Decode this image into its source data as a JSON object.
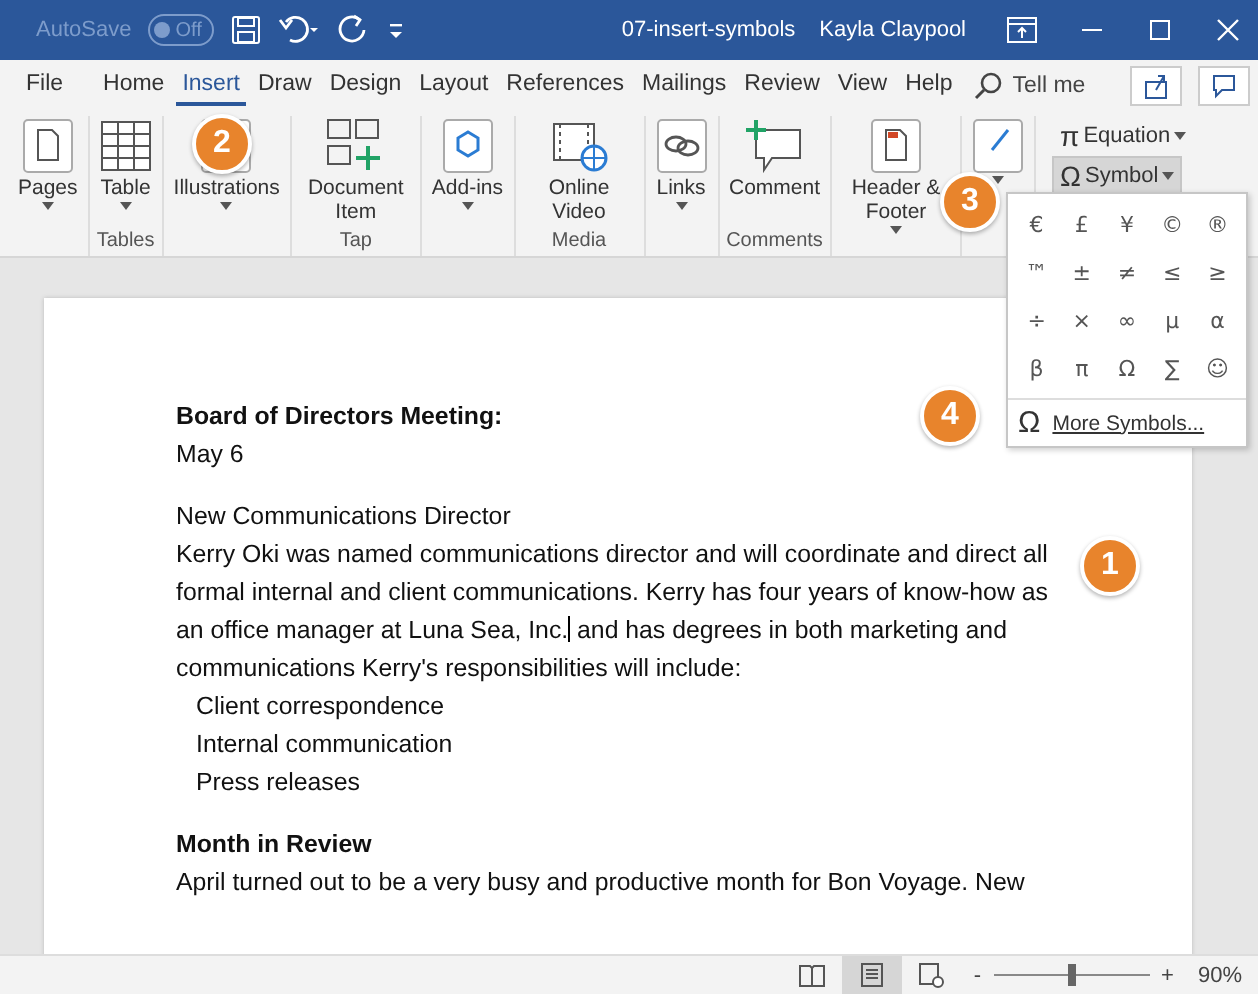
{
  "title_bar": {
    "autosave": {
      "label": "AutoSave",
      "toggle": "Off",
      "on": false
    },
    "document_title": "07-insert-symbols",
    "user": "Kayla Claypool"
  },
  "tabs": [
    {
      "label": "File",
      "selected": false
    },
    {
      "label": "Home",
      "selected": false
    },
    {
      "label": "Insert",
      "selected": true
    },
    {
      "label": "Draw",
      "selected": false
    },
    {
      "label": "Design",
      "selected": false
    },
    {
      "label": "Layout",
      "selected": false
    },
    {
      "label": "References",
      "selected": false
    },
    {
      "label": "Mailings",
      "selected": false
    },
    {
      "label": "Review",
      "selected": false
    },
    {
      "label": "View",
      "selected": false
    },
    {
      "label": "Help",
      "selected": false
    }
  ],
  "tell_me": "Tell me",
  "ribbon_groups": [
    {
      "buttons": [
        {
          "label": "Pages",
          "dropdown": true
        }
      ]
    },
    {
      "label": "Tables",
      "buttons": [
        {
          "label": "Table",
          "dropdown": true
        }
      ]
    },
    {
      "buttons": [
        {
          "label": "Illustrations",
          "dropdown": true
        }
      ]
    },
    {
      "label": "Tap",
      "buttons": [
        {
          "label": "Document Item",
          "dropdown": false
        }
      ]
    },
    {
      "buttons": [
        {
          "label": "Add-ins",
          "dropdown": true
        }
      ]
    },
    {
      "label": "Media",
      "buttons": [
        {
          "label": "Online Video",
          "dropdown": false
        }
      ]
    },
    {
      "buttons": [
        {
          "label": "Links",
          "dropdown": true
        }
      ]
    },
    {
      "label": "Comments",
      "buttons": [
        {
          "label": "Comment",
          "dropdown": false
        }
      ]
    },
    {
      "buttons": [
        {
          "label": "Header & Footer",
          "dropdown": true
        }
      ]
    },
    {
      "buttons": [
        {
          "dropdown": true
        }
      ]
    }
  ],
  "symbols_group": {
    "equation": {
      "glyph": "π",
      "label": "Equation"
    },
    "symbol": {
      "glyph": "Ω",
      "label": "Symbol",
      "expanded": true
    }
  },
  "symbol_menu": {
    "symbols": [
      "€",
      "£",
      "¥",
      "©",
      "®",
      "™",
      "±",
      "≠",
      "≤",
      "≥",
      "÷",
      "×",
      "∞",
      "µ",
      "α",
      "β",
      "π",
      "Ω",
      "∑",
      "☺"
    ],
    "more": {
      "glyph": "Ω",
      "label": "More Symbols..."
    }
  },
  "document": [
    {
      "kind": "heading",
      "text": "Board of Directors Meeting:"
    },
    {
      "kind": "line",
      "text": "May 6"
    },
    {
      "kind": "gap"
    },
    {
      "kind": "line",
      "text": "New Communications Director"
    },
    {
      "kind": "cursor",
      "text": "Kerry Oki was named communications director and will coordinate and direct all formal internal and client communications. Kerry has four years of know-how as an office manager at Luna Sea, Inc.",
      "after_cursor": " and has degrees in both marketing and communications Kerry's responsibilities will include:"
    },
    {
      "kind": "list",
      "text": "Client correspondence"
    },
    {
      "kind": "list",
      "text": "Internal communication"
    },
    {
      "kind": "list",
      "text": "Press releases"
    },
    {
      "kind": "gap"
    },
    {
      "kind": "heading",
      "text": "Month in Review"
    },
    {
      "kind": "line",
      "text": "April turned out to be a very busy and productive month for Bon Voyage. New"
    }
  ],
  "callouts": [
    "1",
    "2",
    "3",
    "4"
  ],
  "status_bar": {
    "views": [
      {
        "selected": false
      },
      {
        "selected": true
      },
      {
        "selected": false
      }
    ],
    "zoom": {
      "minus": "-",
      "plus": "+",
      "level": 0.5,
      "reading": "90%"
    }
  }
}
